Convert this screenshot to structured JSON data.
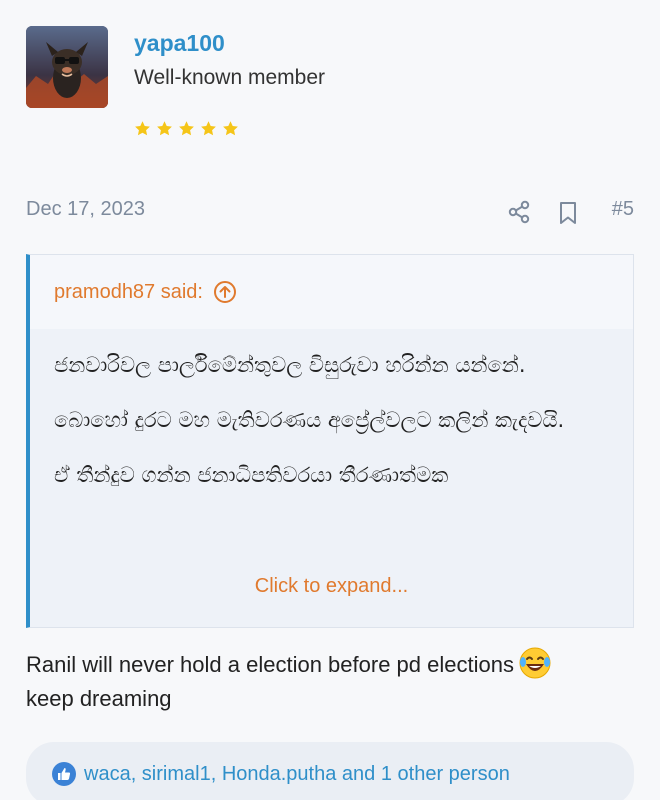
{
  "user": {
    "name": "yapa100",
    "title": "Well-known member",
    "rating": 5,
    "colors": {
      "name": "#2f8fc9",
      "star": "#f5c518"
    }
  },
  "post": {
    "date": "Dec 17, 2023",
    "number": "#5",
    "actions": {
      "share_icon": "share-icon",
      "bookmark_icon": "bookmark-icon"
    }
  },
  "quote": {
    "author_label": "pramodh87 said:",
    "paragraphs": [
      "ජනවාරිවල පාර්ලිමේන්තුවල විසුරුවා හරින්න යන්නේ.",
      "බොහෝ දුරට මහ මැතිවරණය අප්‍රේල්වලට කලින් කැදවයි.",
      "ඒ තීන්දුව ගන්න ජනාධිපතිවරයා තීරණාත්මක"
    ],
    "expand_label": "Click to expand...",
    "accent": "#e07a2e"
  },
  "message": {
    "line1": "Ranil will never hold a election before pd elections",
    "line2": "keep dreaming"
  },
  "reactions": {
    "text": "waca, sirimal1, Honda.putha and 1 other person",
    "icon": "like-icon"
  }
}
